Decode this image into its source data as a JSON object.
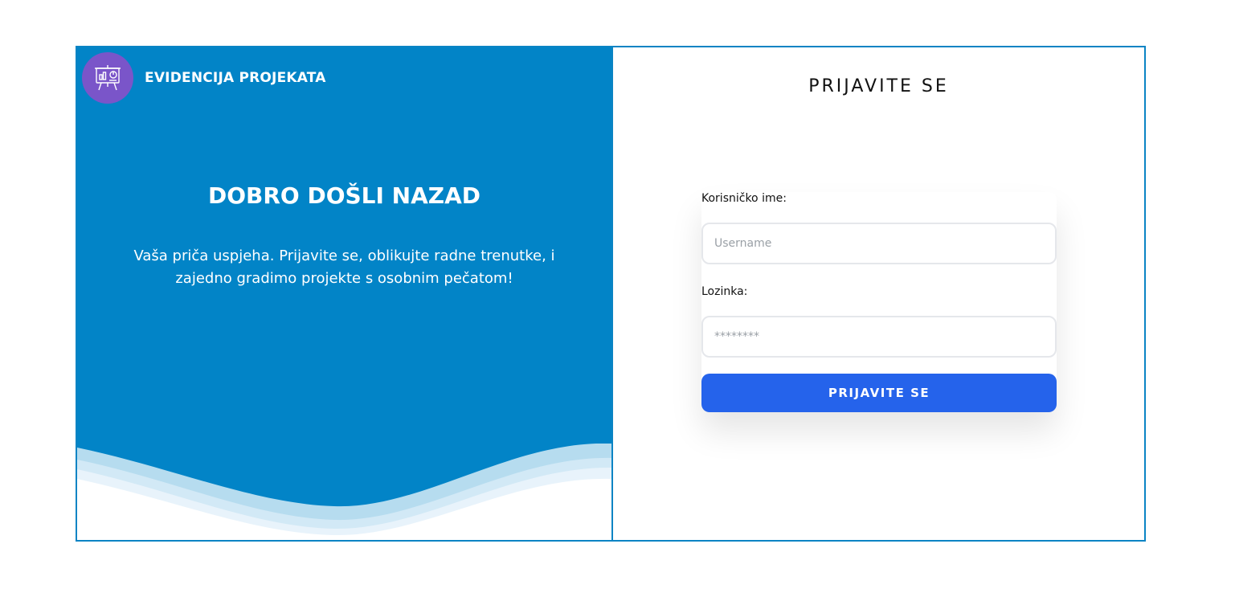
{
  "brand": {
    "name": "EVIDENCIJA PROJEKATA",
    "icon": "presentation-board-icon"
  },
  "welcome": {
    "title": "DOBRO DOŠLI NAZAD",
    "text": "Vaša priča uspjeha. Prijavite se, oblikujte radne trenutke, i zajedno gradimo projekte s osobnim pečatom!"
  },
  "login": {
    "title": "PRIJAVITE SE",
    "username_label": "Korisničko ime:",
    "username_placeholder": "Username",
    "password_label": "Lozinka:",
    "password_placeholder": "********",
    "submit_label": "PRIJAVITE SE"
  },
  "colors": {
    "left_panel": "#0284c7",
    "logo_bg": "#7a55c9",
    "button": "#2563eb",
    "border": "#0a84c4"
  }
}
